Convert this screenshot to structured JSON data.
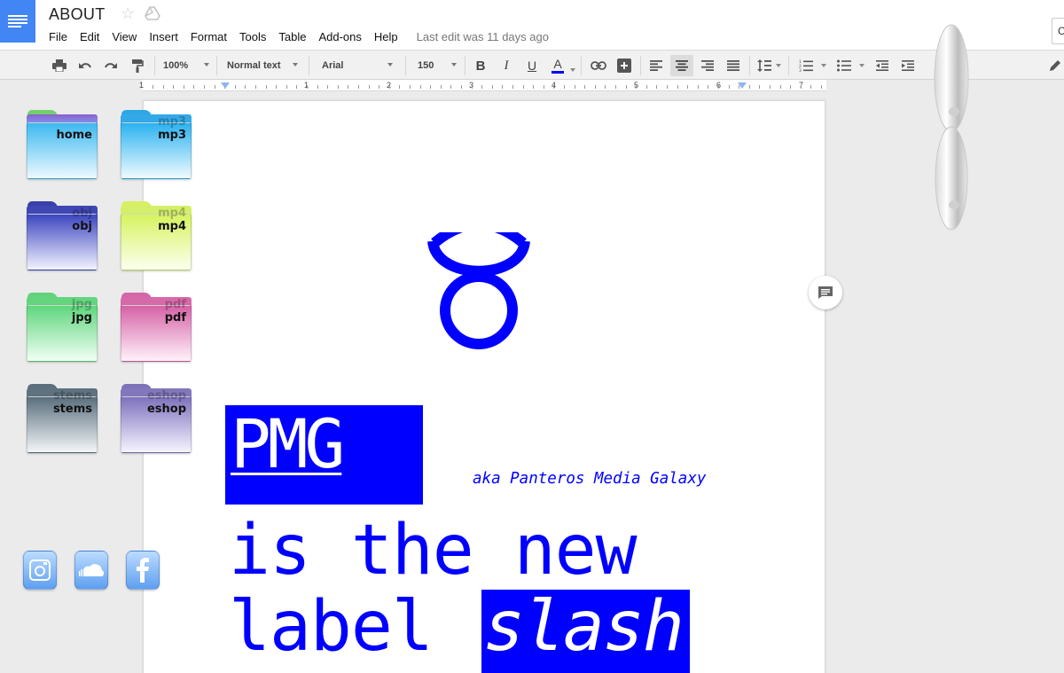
{
  "header": {
    "title": "ABOUT",
    "last_edit": "Last edit was 11 days ago",
    "menu": [
      "File",
      "Edit",
      "View",
      "Insert",
      "Format",
      "Tools",
      "Table",
      "Add-ons",
      "Help"
    ],
    "right_button_label": "C"
  },
  "toolbar": {
    "zoom": "100%",
    "style": "Normal text",
    "font": "Arial",
    "font_size": "150",
    "bold": "B",
    "italic": "I",
    "underline": "U",
    "text_color": "A",
    "text_color_value": "#0000ff",
    "active_alignment": "center"
  },
  "ruler": {
    "numbers": [
      "1",
      "1",
      "2",
      "3",
      "4",
      "5",
      "6",
      "7"
    ]
  },
  "document": {
    "heading": "PMG",
    "aka": "aka Panteros Media Galaxy",
    "line2": "is the new",
    "line3_plain": "label ",
    "line3_highlight": "slash",
    "accent": "#0000ff"
  },
  "desktop": {
    "folders": [
      {
        "label": "home",
        "ghost": ""
      },
      {
        "label": "mp3",
        "ghost": "mp3"
      },
      {
        "label": "obj",
        "ghost": "obj"
      },
      {
        "label": "mp4",
        "ghost": "mp4"
      },
      {
        "label": "jpg",
        "ghost": "jpg"
      },
      {
        "label": "pdf",
        "ghost": "pdf"
      },
      {
        "label": "stems",
        "ghost": "stems"
      },
      {
        "label": "eshop",
        "ghost": "eshop"
      }
    ],
    "social": [
      "instagram-icon",
      "soundcloud-icon",
      "facebook-icon"
    ]
  }
}
